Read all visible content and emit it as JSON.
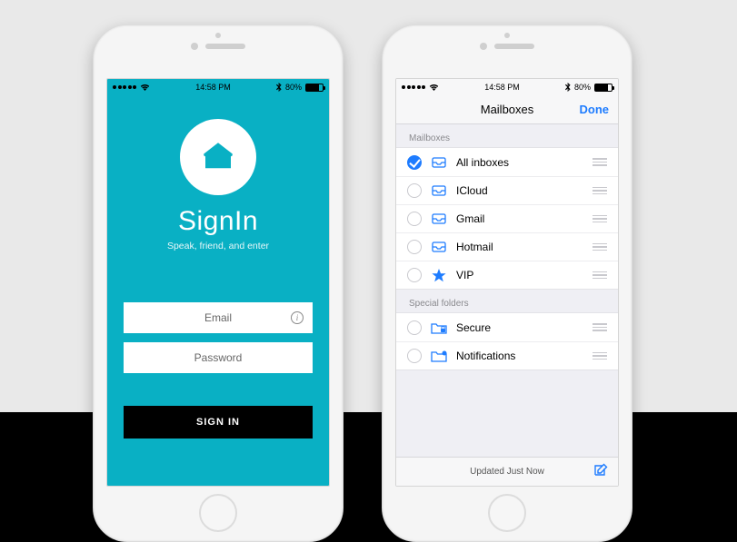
{
  "status": {
    "time": "14:58 PM",
    "battery_pct": "80%"
  },
  "signin": {
    "title": "SignIn",
    "subtitle": "Speak, friend, and enter",
    "email_placeholder": "Email",
    "password_placeholder": "Password",
    "button": "SIGN IN"
  },
  "mail": {
    "nav_title": "Mailboxes",
    "done": "Done",
    "section_mailboxes": "Mailboxes",
    "section_special": "Special folders",
    "items": [
      {
        "label": "All inboxes",
        "icon": "tray",
        "checked": true
      },
      {
        "label": "ICloud",
        "icon": "tray",
        "checked": false
      },
      {
        "label": "Gmail",
        "icon": "tray",
        "checked": false
      },
      {
        "label": "Hotmail",
        "icon": "tray",
        "checked": false
      },
      {
        "label": "VIP",
        "icon": "star",
        "checked": false
      }
    ],
    "special": [
      {
        "label": "Secure",
        "icon": "folder-lock",
        "checked": false
      },
      {
        "label": "Notifications",
        "icon": "folder-badge",
        "checked": false
      }
    ],
    "updated": "Updated Just Now"
  }
}
